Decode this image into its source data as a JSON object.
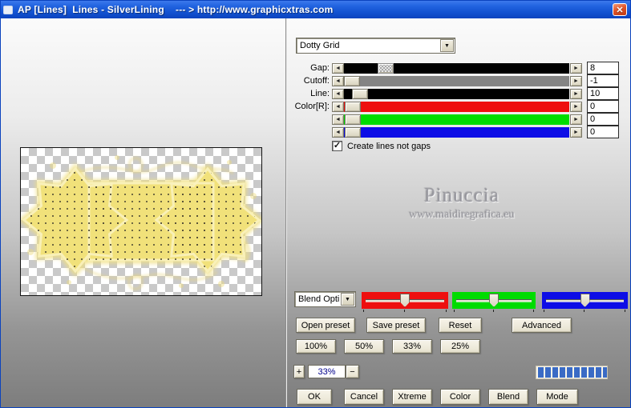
{
  "window": {
    "title": "AP [Lines]  Lines - SilverLining    --- > http://www.graphicxtras.com"
  },
  "icons": {
    "close": "✕",
    "dropdown_arrow": "▼",
    "left_arrow": "◄",
    "right_arrow": "►",
    "check": "✓"
  },
  "preset_dropdown": {
    "value": "Dotty Grid"
  },
  "sliders": [
    {
      "label": "Gap:",
      "value": "8",
      "track_color": "#000000"
    },
    {
      "label": "Cutoff:",
      "value": "-1",
      "track_color": "#848484"
    },
    {
      "label": "Line:",
      "value": "10",
      "track_color": "#000000"
    },
    {
      "label": "Color[R]:",
      "value": "0",
      "track_color": "#ee0f0f"
    },
    {
      "label": "",
      "value": "0",
      "track_color": "#00dc00"
    },
    {
      "label": "",
      "value": "0",
      "track_color": "#0d0de6"
    }
  ],
  "checkbox": {
    "label": "Create lines not gaps",
    "checked": true
  },
  "watermark": {
    "line1": "Pinuccia",
    "line2": "www.maidiregrafica.eu"
  },
  "blend": {
    "dropdown_value": "Blend Opti",
    "slider_colors": [
      "#ee0f0f",
      "#00dc00",
      "#0d0de6"
    ]
  },
  "preset_buttons": {
    "open": "Open preset",
    "save": "Save preset",
    "reset": "Reset",
    "advanced": "Advanced"
  },
  "zoom_buttons": {
    "b100": "100%",
    "b50": "50%",
    "b33": "33%",
    "b25": "25%"
  },
  "zoom_control": {
    "plus": "+",
    "value": "33%",
    "minus": "−"
  },
  "progress": {
    "segments": 10,
    "color": "#3a6bc5"
  },
  "bottom_buttons": {
    "ok": "OK",
    "cancel": "Cancel",
    "xtreme": "Xtreme",
    "color": "Color",
    "blend": "Blend",
    "mode": "Mode"
  }
}
